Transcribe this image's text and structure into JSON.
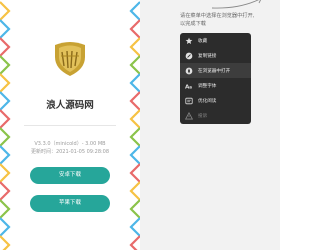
{
  "app": {
    "name": "浪人源码网",
    "version_line": "V3.3.0（minicold）- 3.00 MB",
    "updated_line": "更新时间：2021-01-05 09:28:08",
    "android_button": "安卓下载",
    "apple_button": "苹果下载"
  },
  "hint": {
    "line1": "请在菜单中选择在浏览器中打开,",
    "line2": "以完成下载"
  },
  "menu": {
    "items": [
      {
        "label": "收藏",
        "icon": "star-icon"
      },
      {
        "label": "复制链接",
        "icon": "link-icon"
      },
      {
        "label": "在浏览器中打开",
        "icon": "compass-icon"
      },
      {
        "label": "调整字体",
        "icon": "font-size-icon"
      },
      {
        "label": "优化阅读",
        "icon": "reader-icon"
      },
      {
        "label": "投诉",
        "icon": "warning-icon"
      }
    ]
  },
  "colors": {
    "accent": "#26a69a",
    "menu_bg": "#2c2c2c",
    "right_bg": "#f2f2f2",
    "logo_gold": "#c8a233"
  }
}
